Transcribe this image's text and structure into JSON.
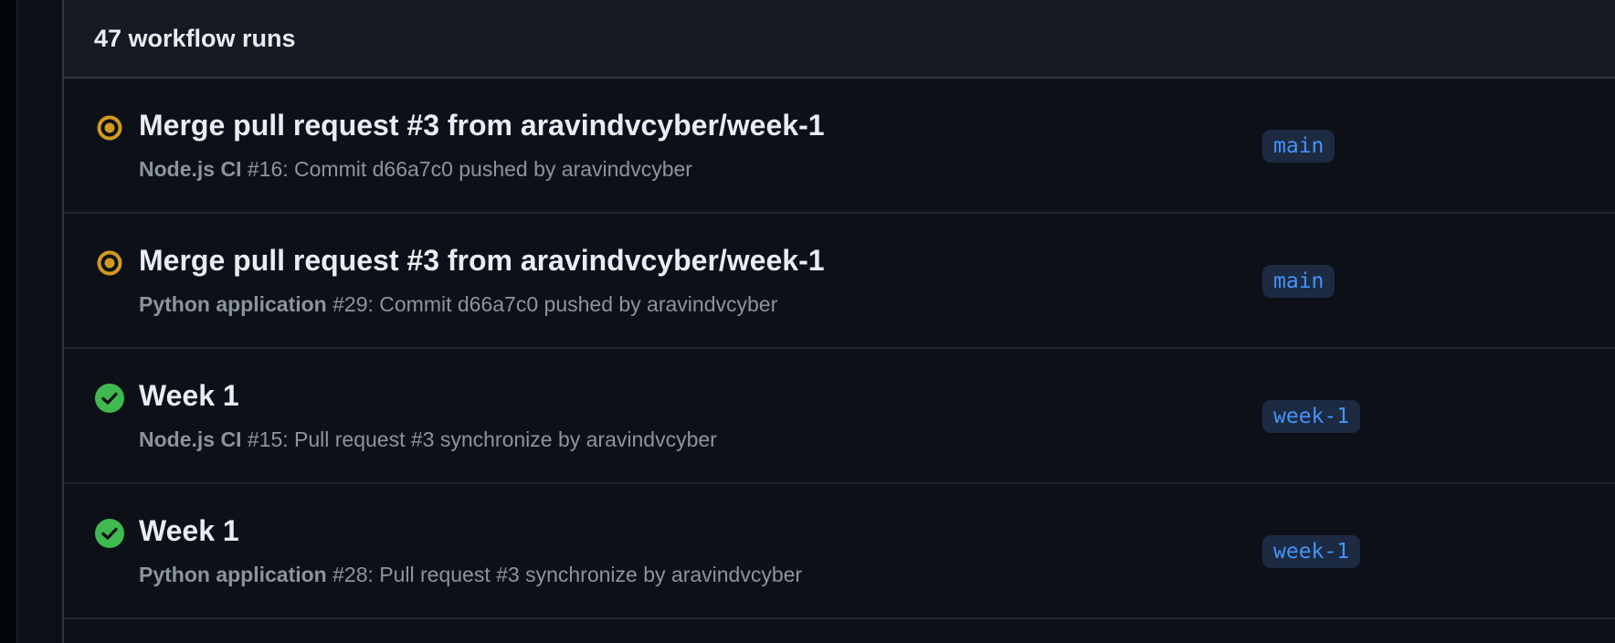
{
  "header": {
    "count_label": "47 workflow runs"
  },
  "colors": {
    "in_progress": "#d29922",
    "success": "#3fb950",
    "branch_text": "#4493f8",
    "branch_bg": "#1c2a42",
    "background": "#0d1117"
  },
  "runs": [
    {
      "status": "in-progress",
      "status_icon": "in-progress-icon",
      "title": "Merge pull request #3 from aravindvcyber/week-1",
      "workflow": "Node.js CI",
      "detail": " #16: Commit d66a7c0 pushed by aravindvcyber",
      "branch": "main"
    },
    {
      "status": "in-progress",
      "status_icon": "in-progress-icon",
      "title": "Merge pull request #3 from aravindvcyber/week-1",
      "workflow": "Python application",
      "detail": " #29: Commit d66a7c0 pushed by aravindvcyber",
      "branch": "main"
    },
    {
      "status": "success",
      "status_icon": "check-circle-icon",
      "title": "Week 1",
      "workflow": "Node.js CI",
      "detail": " #15: Pull request #3 synchronize by aravindvcyber",
      "branch": "week-1"
    },
    {
      "status": "success",
      "status_icon": "check-circle-icon",
      "title": "Week 1",
      "workflow": "Python application",
      "detail": " #28: Pull request #3 synchronize by aravindvcyber",
      "branch": "week-1"
    }
  ]
}
